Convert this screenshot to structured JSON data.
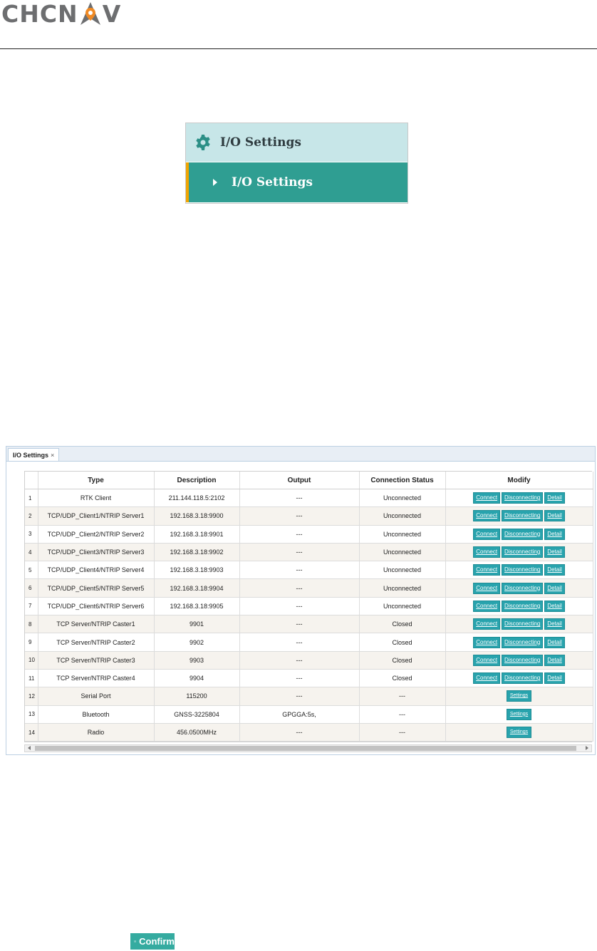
{
  "brand": {
    "name_left": "CHCN",
    "name_right": "V",
    "accent": "#f08a24"
  },
  "menu": {
    "section_title": "I/O Settings",
    "item_label": "I/O Settings",
    "section_icon": "gear-icon",
    "item_icon": "caret-right-icon"
  },
  "panel": {
    "tab_label": "I/O Settings",
    "tab_close": "×",
    "columns": [
      "",
      "Type",
      "Description",
      "Output",
      "Connection Status",
      "Modify"
    ],
    "rows": [
      {
        "n": "1",
        "type": "RTK Client",
        "desc": "211.144.118.5:2102",
        "output": "---",
        "status": "Unconnected",
        "kind": "conn"
      },
      {
        "n": "2",
        "type": "TCP/UDP_Client1/NTRIP Server1",
        "desc": "192.168.3.18:9900",
        "output": "---",
        "status": "Unconnected",
        "kind": "conn"
      },
      {
        "n": "3",
        "type": "TCP/UDP_Client2/NTRIP Server2",
        "desc": "192.168.3.18:9901",
        "output": "---",
        "status": "Unconnected",
        "kind": "conn"
      },
      {
        "n": "4",
        "type": "TCP/UDP_Client3/NTRIP Server3",
        "desc": "192.168.3.18:9902",
        "output": "---",
        "status": "Unconnected",
        "kind": "conn"
      },
      {
        "n": "5",
        "type": "TCP/UDP_Client4/NTRIP Server4",
        "desc": "192.168.3.18:9903",
        "output": "---",
        "status": "Unconnected",
        "kind": "conn"
      },
      {
        "n": "6",
        "type": "TCP/UDP_Client5/NTRIP Server5",
        "desc": "192.168.3.18:9904",
        "output": "---",
        "status": "Unconnected",
        "kind": "conn"
      },
      {
        "n": "7",
        "type": "TCP/UDP_Client6/NTRIP Server6",
        "desc": "192.168.3.18:9905",
        "output": "---",
        "status": "Unconnected",
        "kind": "conn"
      },
      {
        "n": "8",
        "type": "TCP Server/NTRIP Caster1",
        "desc": "9901",
        "output": "---",
        "status": "Closed",
        "kind": "conn"
      },
      {
        "n": "9",
        "type": "TCP Server/NTRIP Caster2",
        "desc": "9902",
        "output": "---",
        "status": "Closed",
        "kind": "conn"
      },
      {
        "n": "10",
        "type": "TCP Server/NTRIP Caster3",
        "desc": "9903",
        "output": "---",
        "status": "Closed",
        "kind": "conn"
      },
      {
        "n": "11",
        "type": "TCP Server/NTRIP Caster4",
        "desc": "9904",
        "output": "---",
        "status": "Closed",
        "kind": "conn"
      },
      {
        "n": "12",
        "type": "Serial Port",
        "desc": "115200",
        "output": "---",
        "status": "---",
        "kind": "settings"
      },
      {
        "n": "13",
        "type": "Bluetooth",
        "desc": "GNSS-3225804",
        "output": "GPGGA:5s,",
        "status": "---",
        "kind": "settings"
      },
      {
        "n": "14",
        "type": "Radio",
        "desc": "456.0500MHz",
        "output": "---",
        "status": "---",
        "kind": "settings"
      }
    ],
    "buttons": {
      "connect": "Connect",
      "disconnect": "Disconnecting",
      "detail": "Detail",
      "settings": "Settings"
    }
  },
  "confirm": {
    "label": "Confirm",
    "icon": "check-circle-icon"
  },
  "colors": {
    "teal": "#2f9e92",
    "menu_head_bg": "#c7e6e8",
    "button": "#28a3ad",
    "accent_bar": "#f0a500"
  }
}
